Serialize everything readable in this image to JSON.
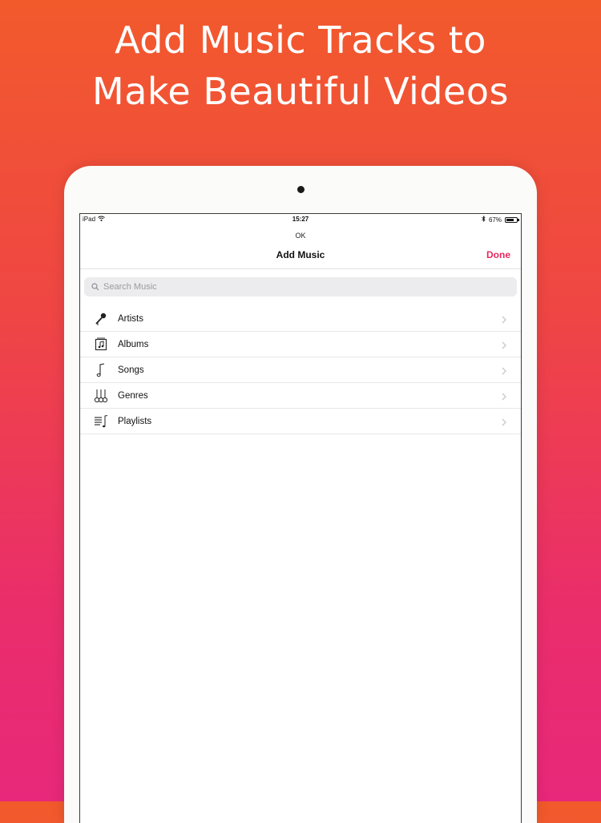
{
  "headline": {
    "line1": "Add Music Tracks to",
    "line2": "Make Beautiful Videos"
  },
  "status_bar": {
    "device": "iPad",
    "time": "15:27",
    "battery": "67%",
    "battery_level": 0.67
  },
  "ok_label": "OK",
  "navbar": {
    "title": "Add Music",
    "done_label": "Done"
  },
  "search": {
    "placeholder": "Search Music"
  },
  "list": [
    {
      "label": "Artists",
      "icon": "microphone-icon"
    },
    {
      "label": "Albums",
      "icon": "album-icon"
    },
    {
      "label": "Songs",
      "icon": "music-note-icon"
    },
    {
      "label": "Genres",
      "icon": "guitars-icon"
    },
    {
      "label": "Playlists",
      "icon": "playlist-icon"
    }
  ],
  "colors": {
    "accent": "#e8285f",
    "gradient_top": "#f25a2c",
    "gradient_bottom": "#e8287a"
  }
}
